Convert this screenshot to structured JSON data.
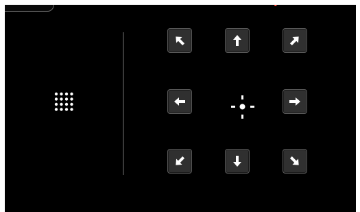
{
  "title": "",
  "controls": {
    "grid_toggle": {
      "icon": "dot-grid-icon",
      "color": "#ffffff"
    },
    "pan_buttons": [
      {
        "direction": "up-left",
        "icon": "arrow-up-left-icon"
      },
      {
        "direction": "up",
        "icon": "arrow-up-icon"
      },
      {
        "direction": "up-right",
        "icon": "arrow-up-right-icon"
      },
      {
        "direction": "left",
        "icon": "arrow-left-icon"
      },
      {
        "direction": "right",
        "icon": "arrow-right-icon"
      },
      {
        "direction": "down-left",
        "icon": "arrow-down-left-icon"
      },
      {
        "direction": "down",
        "icon": "arrow-down-icon"
      },
      {
        "direction": "down-right",
        "icon": "arrow-down-right-icon"
      }
    ],
    "center_icon": "crosshair-icon"
  },
  "colors": {
    "background": "#000000",
    "button_fill": "#303030",
    "button_border": "#5a5a5a",
    "icon": "#ffffff",
    "divider": "#3a3a3a"
  }
}
